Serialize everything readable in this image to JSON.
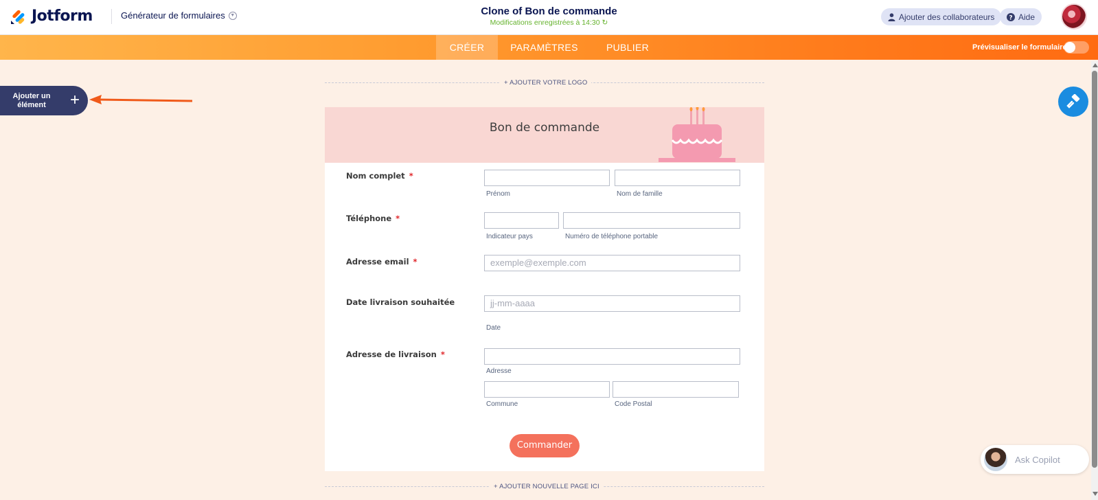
{
  "header": {
    "logo_text": "Jotform",
    "builder_menu": "Générateur de formulaires",
    "form_title": "Clone of Bon de commande",
    "saved_status": "Modifications enregistrées à 14:30",
    "collaborators_button": "Ajouter des collaborateurs",
    "help_button": "Aide"
  },
  "nav": {
    "tabs": [
      {
        "label": "CRÉER",
        "active": true
      },
      {
        "label": "PARAMÈTRES",
        "active": false
      },
      {
        "label": "PUBLIER",
        "active": false
      }
    ],
    "preview_label": "Prévisualiser le formulaire",
    "preview_on": false
  },
  "sidebar": {
    "add_element_label": "Ajouter un élément"
  },
  "form": {
    "add_logo": "+ AJOUTER VOTRE LOGO",
    "heading": "Bon de commande",
    "fields": [
      {
        "label": "Nom complet",
        "required": true,
        "sublabels": [
          "Prénom",
          "Nom de famille"
        ]
      },
      {
        "label": "Téléphone",
        "required": true,
        "sublabels": [
          "Indicateur pays",
          "Numéro de téléphone portable"
        ]
      },
      {
        "label": "Adresse email",
        "required": true,
        "placeholder": "exemple@exemple.com"
      },
      {
        "label": "Date livraison souhaitée",
        "required": false,
        "placeholder": "jj-mm-aaaa",
        "sublabel": "Date"
      },
      {
        "label": "Adresse de livraison",
        "required": true,
        "sublabels": [
          "Adresse",
          "Commune",
          "Code Postal"
        ]
      }
    ],
    "required_mark": "*",
    "submit_label": "Commander",
    "add_page": "+ AJOUTER NOUVELLE PAGE ICI"
  },
  "copilot": {
    "label": "Ask Copilot"
  },
  "colors": {
    "brand_navy": "#0a1551",
    "nav_gradient_start": "#ffb54b",
    "nav_gradient_end": "#ff6b12",
    "form_header_bg": "#f9d7d3",
    "submit_bg": "#f4715c",
    "designer_blue": "#1a8ce0",
    "saved_green": "#64b22c",
    "required_red": "#e0262a"
  }
}
